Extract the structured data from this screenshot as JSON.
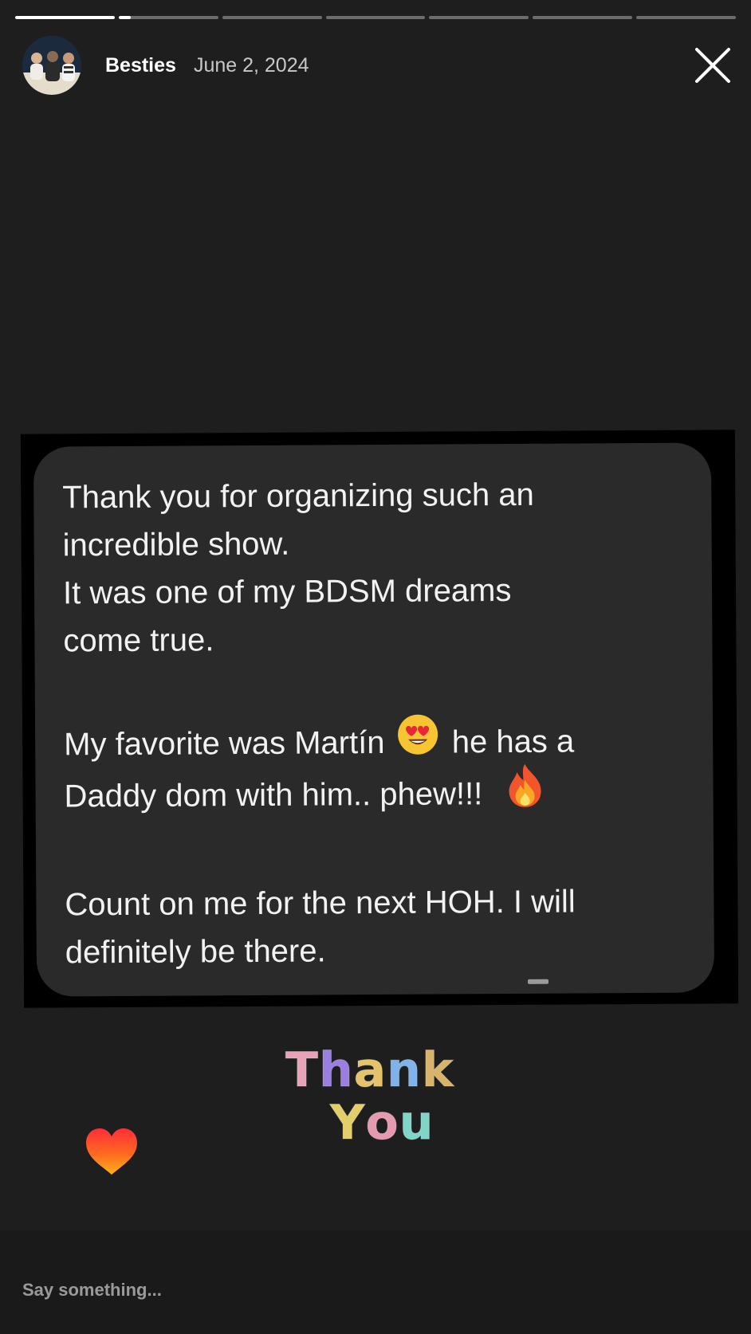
{
  "story": {
    "segments": [
      {
        "progress": 1.0
      },
      {
        "progress": 0.12
      },
      {
        "progress": 0
      },
      {
        "progress": 0
      },
      {
        "progress": 0
      },
      {
        "progress": 0
      },
      {
        "progress": 0
      }
    ]
  },
  "header": {
    "username": "Besties",
    "date": "June 2, 2024",
    "avatar_icon": "group-photo-avatar",
    "close_icon": "close-icon"
  },
  "message": {
    "lines": [
      "Thank you for organizing such an",
      "incredible show.",
      "It was one of my BDSM dreams",
      "come true."
    ],
    "para2_line1_a": "My favorite was Martín",
    "para2_line1_b": "he has a",
    "para2_line2": "Daddy dom with him.. phew!!!",
    "para3": [
      "Count on me for the next HOH. I will",
      "definitely be there."
    ],
    "emoji_1": "heart-eyes-emoji",
    "emoji_2": "fire-emoji"
  },
  "stickers": {
    "thank_word": "Thank",
    "you_word": "You",
    "heart": "heart-sticker",
    "thank_colors": [
      "#e8a3b8",
      "#9b7fe0",
      "#e6c36a",
      "#7fb3ea",
      "#d8b36a"
    ],
    "you_colors": [
      "#e3cf6a",
      "#e59ab0",
      "#7fd6c6"
    ]
  },
  "reply": {
    "placeholder": "Say something..."
  }
}
